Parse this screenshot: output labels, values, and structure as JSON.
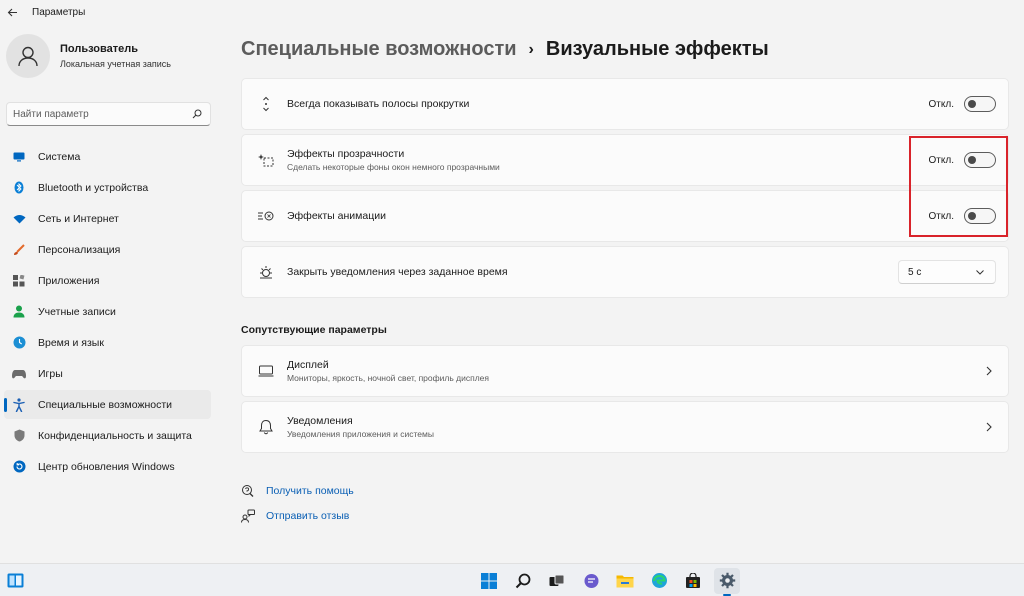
{
  "window": {
    "title": "Параметры"
  },
  "profile": {
    "name": "Пользователь",
    "account_type": "Локальная учетная запись"
  },
  "search": {
    "placeholder": "Найти параметр"
  },
  "sidebar": {
    "items": [
      {
        "label": "Система",
        "icon": "monitor-icon",
        "color": "#0067c0"
      },
      {
        "label": "Bluetooth и устройства",
        "icon": "bluetooth-icon",
        "color": "#0a7fd6"
      },
      {
        "label": "Сеть и Интернет",
        "icon": "wifi-icon",
        "color": "#0067c0"
      },
      {
        "label": "Персонализация",
        "icon": "brush-icon",
        "color": "#e36a2b"
      },
      {
        "label": "Приложения",
        "icon": "apps-icon",
        "color": "#555555"
      },
      {
        "label": "Учетные записи",
        "icon": "person-icon",
        "color": "#1aa14b"
      },
      {
        "label": "Время и язык",
        "icon": "globe-clock-icon",
        "color": "#1c8fd4"
      },
      {
        "label": "Игры",
        "icon": "gamepad-icon",
        "color": "#6b6b6b"
      },
      {
        "label": "Специальные возможности",
        "icon": "accessibility-icon",
        "color": "#1a5fb4",
        "active": true
      },
      {
        "label": "Конфиденциальность и защита",
        "icon": "shield-icon",
        "color": "#6b6b6b"
      },
      {
        "label": "Центр обновления Windows",
        "icon": "update-icon",
        "color": "#0067c0"
      }
    ]
  },
  "breadcrumb": {
    "parent": "Специальные возможности",
    "separator": "›",
    "current": "Визуальные эффекты"
  },
  "settings": {
    "scrollbars": {
      "title": "Всегда показывать полосы прокрутки",
      "state": "Откл.",
      "on": false
    },
    "transparency": {
      "title": "Эффекты прозрачности",
      "subtitle": "Сделать некоторые фоны окон немного прозрачными",
      "state": "Откл.",
      "on": false
    },
    "animation": {
      "title": "Эффекты анимации",
      "state": "Откл.",
      "on": false
    },
    "notifications_timeout": {
      "title": "Закрыть уведомления через заданное время",
      "value": "5 с"
    }
  },
  "related": {
    "heading": "Сопутствующие параметры",
    "items": [
      {
        "title": "Дисплей",
        "subtitle": "Мониторы, яркость, ночной свет, профиль дисплея"
      },
      {
        "title": "Уведомления",
        "subtitle": "Уведомления приложения и системы"
      }
    ]
  },
  "links": {
    "help": "Получить помощь",
    "feedback": "Отправить отзыв"
  },
  "colors": {
    "accent": "#0067c0",
    "link": "#0a5fb4",
    "highlight_box": "#d9232a"
  },
  "taskbar": {
    "icons": [
      "start-icon",
      "search-icon",
      "task-view-icon",
      "chat-icon",
      "file-explorer-icon",
      "edge-icon",
      "store-icon",
      "settings-icon"
    ]
  }
}
